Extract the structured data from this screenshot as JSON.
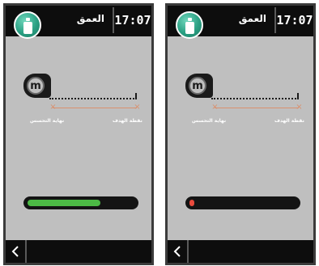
{
  "screens": [
    {
      "time": "17:07",
      "title": "العمق",
      "app_icon": "bottle-icon",
      "tape_unit": "m",
      "label_start": "نهاية التحسس",
      "label_end": "نقطة الهدف",
      "progress_fraction": 0.68,
      "progress_color": "#4cba45",
      "back_icon": "chevron-left-icon"
    },
    {
      "time": "17:07",
      "title": "العمق",
      "app_icon": "bottle-icon",
      "tape_unit": "m",
      "label_start": "نهاية التحسس",
      "label_end": "نقطة الهدف",
      "progress_fraction": 0.02,
      "progress_color": "#e84a3c",
      "back_icon": "chevron-left-icon"
    }
  ],
  "colors": {
    "header_bg": "#0d0d0d",
    "screen_bg": "#bfbfbf",
    "accent_line": "#d9906e"
  }
}
